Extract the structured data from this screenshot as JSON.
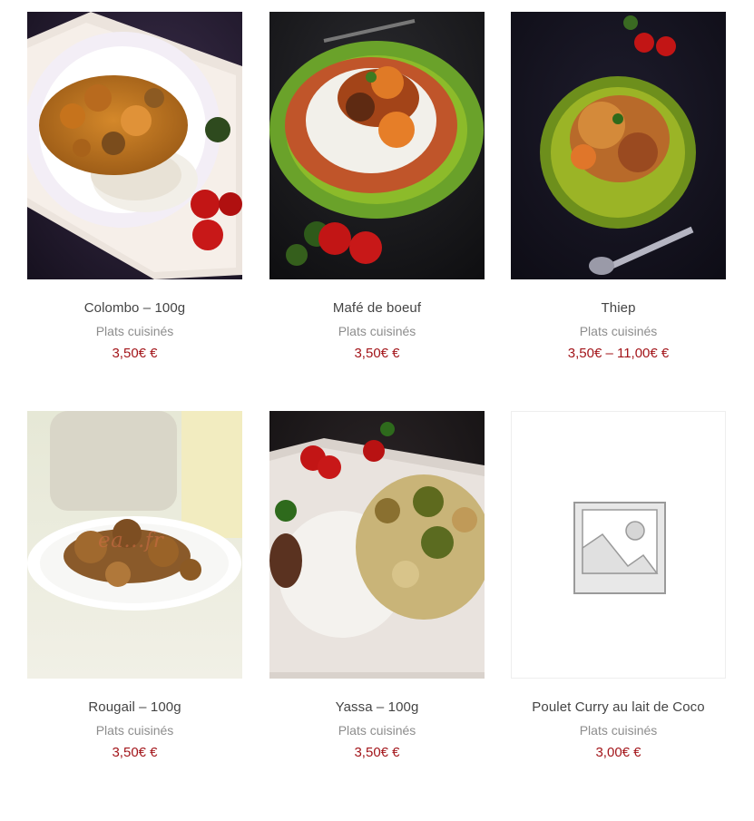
{
  "colors": {
    "title": "#444444",
    "category": "#8d8d8d",
    "price": "#a3151a"
  },
  "products": [
    {
      "title": "Colombo – 100g",
      "category": "Plats cuisinés",
      "price": "3,50€ €",
      "image": "colombo-dish-image"
    },
    {
      "title": "Mafé de boeuf",
      "category": "Plats cuisinés",
      "price": "3,50€ €",
      "image": "mafe-dish-image"
    },
    {
      "title": "Thiep",
      "category": "Plats cuisinés",
      "price": "3,50€ – 11,00€ €",
      "image": "thiep-dish-image"
    },
    {
      "title": "Rougail – 100g",
      "category": "Plats cuisinés",
      "price": "3,50€ €",
      "image": "rougail-dish-image",
      "watermark": "ea...fr"
    },
    {
      "title": "Yassa – 100g",
      "category": "Plats cuisinés",
      "price": "3,50€ €",
      "image": "yassa-dish-image"
    },
    {
      "title": "Poulet Curry au lait de Coco",
      "category": "Plats cuisinés",
      "price": "3,00€ €",
      "image": "placeholder-image-icon"
    }
  ]
}
